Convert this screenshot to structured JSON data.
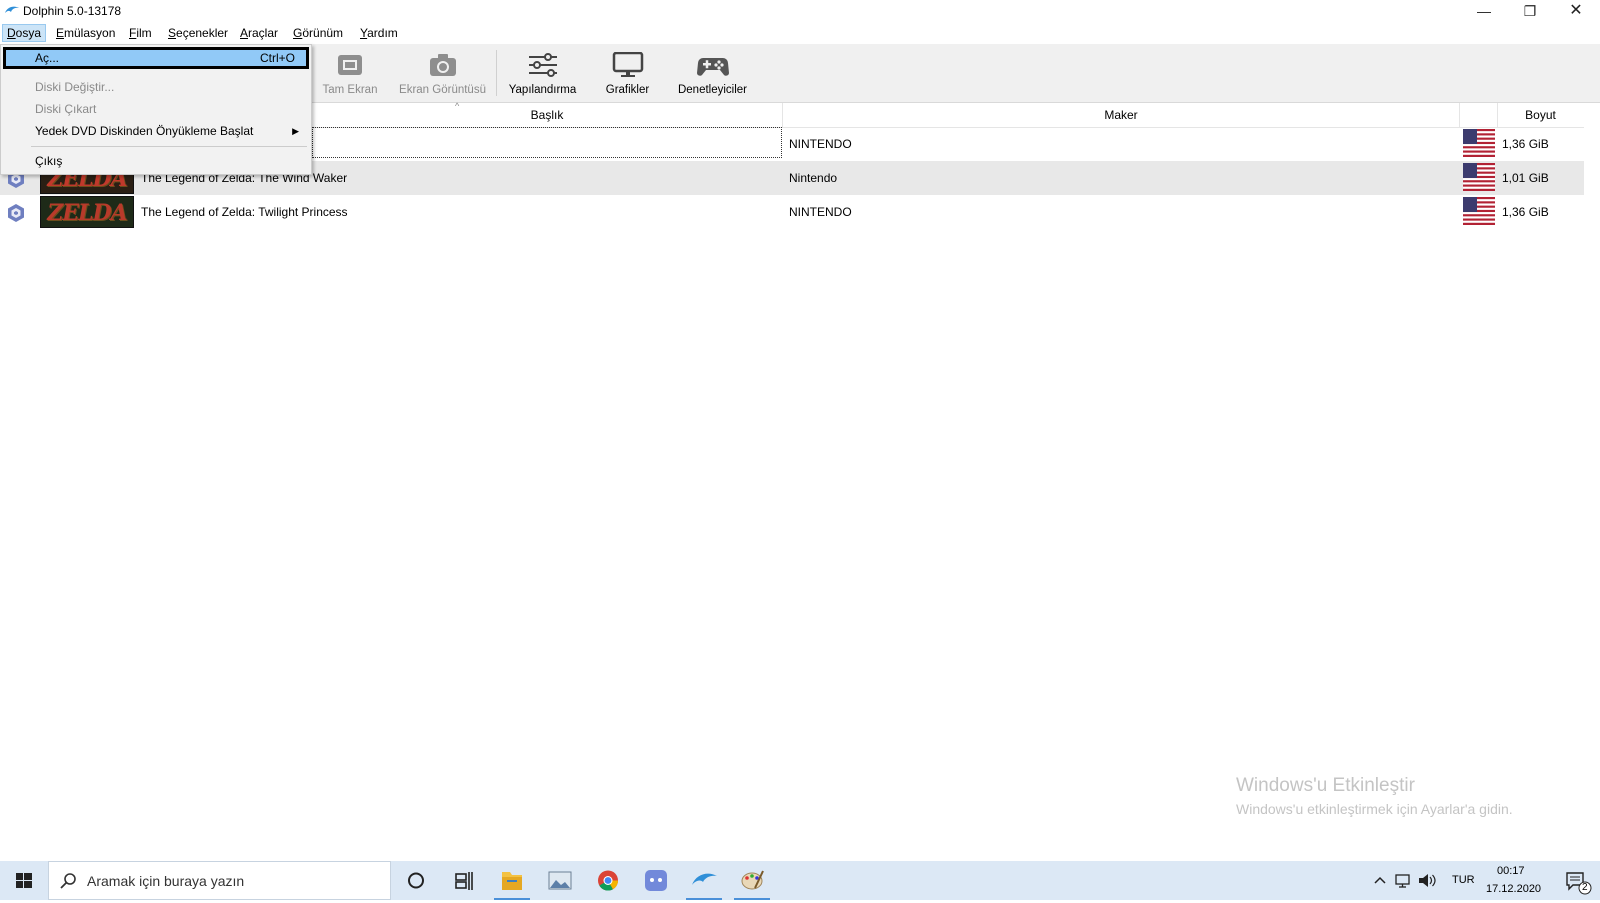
{
  "window": {
    "title": "Dolphin 5.0-13178",
    "minimize": "—",
    "maximize": "❐",
    "close": "✕"
  },
  "menubar": {
    "items": [
      {
        "label": "Dosya",
        "mn": "D",
        "rest": "osya"
      },
      {
        "label": "Emülasyon",
        "mn": "E",
        "rest": "mülasyon"
      },
      {
        "label": "Film",
        "mn": "F",
        "rest": "ilm"
      },
      {
        "label": "Seçenekler",
        "mn": "S",
        "rest": "eçenekler"
      },
      {
        "label": "Araçlar",
        "mn": "A",
        "rest": "raçlar"
      },
      {
        "label": "Görünüm",
        "mn": "G",
        "rest": "örünüm"
      },
      {
        "label": "Yardım",
        "mn": "Y",
        "rest": "ardım"
      }
    ]
  },
  "toolbar": {
    "fullscreen": "Tam Ekran",
    "screenshot": "Ekran Görüntüsü",
    "config": "Yapılandırma",
    "graphics": "Grafikler",
    "controllers": "Denetleyiciler"
  },
  "columns": {
    "title": "Başlık",
    "maker": "Maker",
    "size": "Boyut"
  },
  "games": [
    {
      "title": "",
      "maker": "NINTENDO",
      "size": "1,36 GiB"
    },
    {
      "title": "The Legend of Zelda: The Wind Waker",
      "maker": "Nintendo",
      "size": "1,01 GiB"
    },
    {
      "title": "The Legend of Zelda: Twilight Princess",
      "maker": "NINTENDO",
      "size": "1,36 GiB"
    }
  ],
  "banner_text": "ZELDA",
  "file_menu": {
    "open": "Aç...",
    "open_shortcut": "Ctrl+O",
    "change_disc": "Diski Değiştir...",
    "eject_disc": "Diski Çıkart",
    "boot_dvd": "Yedek DVD Diskinden Önyükleme Başlat",
    "exit": "Çıkış"
  },
  "watermark": {
    "title": "Windows'u Etkinleştir",
    "subtitle": "Windows'u etkinleştirmek için Ayarlar'a gidin."
  },
  "taskbar": {
    "search_placeholder": "Aramak için buraya yazın",
    "language": "TUR",
    "time": "00:17",
    "date": "17.12.2020",
    "notifications": "2"
  },
  "colors": {
    "selection": "#91c9f7",
    "taskbar": "#dce8f5",
    "accent": "#4a90d9"
  }
}
